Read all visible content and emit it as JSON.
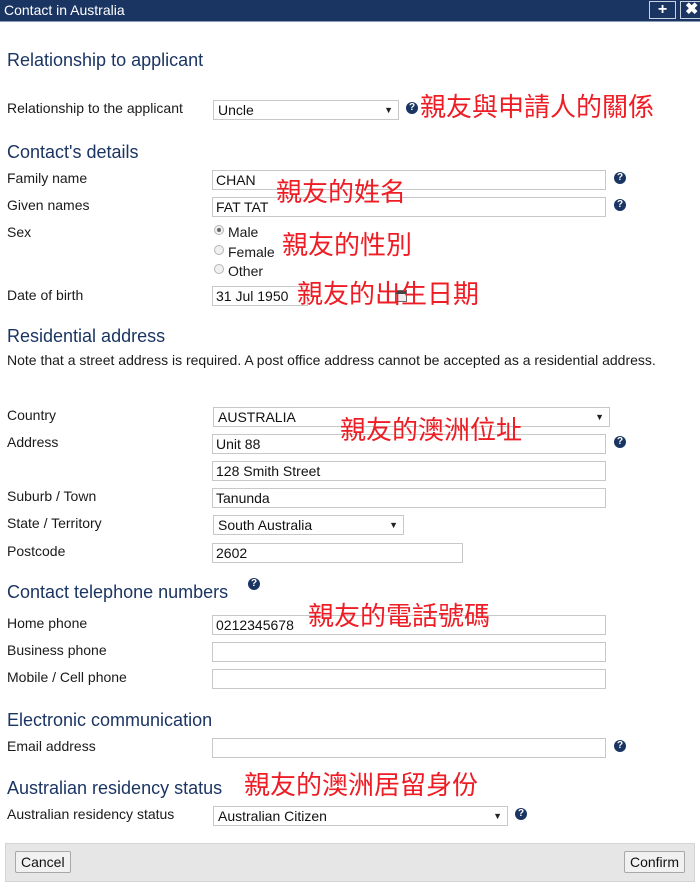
{
  "window": {
    "title": "Contact in Australia",
    "buttons": {
      "maximize_icon": "+",
      "close_icon": "✖"
    }
  },
  "sections": {
    "relationship": {
      "heading": "Relationship to applicant",
      "label": "Relationship to the applicant",
      "value": "Uncle",
      "annotation": "親友與申請人的關係"
    },
    "contact_details": {
      "heading": "Contact's details",
      "family_name_label": "Family name",
      "family_name_value": "CHAN",
      "given_names_label": "Given names",
      "given_names_value": "FAT TAT",
      "name_annotation": "親友的姓名",
      "sex_label": "Sex",
      "sex_options": [
        {
          "label": "Male",
          "checked": true
        },
        {
          "label": "Female",
          "checked": false
        },
        {
          "label": "Other",
          "checked": false
        }
      ],
      "sex_annotation": "親友的性別",
      "dob_label": "Date of birth",
      "dob_value": "31 Jul 1950",
      "dob_annotation": "親友的出生日期"
    },
    "residential_address": {
      "heading": "Residential address",
      "note": "Note that a street address is required. A post office address cannot be accepted as a residential address.",
      "country_label": "Country",
      "country_value": "AUSTRALIA",
      "address_label": "Address",
      "address_line1": "Unit 88",
      "address_line2": "128 Smith Street",
      "suburb_label": "Suburb / Town",
      "suburb_value": "Tanunda",
      "state_label": "State / Territory",
      "state_value": "South Australia",
      "postcode_label": "Postcode",
      "postcode_value": "2602",
      "annotation": "親友的澳洲位址"
    },
    "telephone": {
      "heading": "Contact telephone numbers",
      "home_label": "Home phone",
      "home_value": "0212345678",
      "business_label": "Business phone",
      "business_value": "",
      "mobile_label": "Mobile / Cell phone",
      "mobile_value": "",
      "annotation": "親友的電話號碼"
    },
    "electronic": {
      "heading": "Electronic communication",
      "email_label": "Email address",
      "email_value": ""
    },
    "residency": {
      "heading": "Australian residency status",
      "label": "Australian residency status",
      "value": "Australian Citizen",
      "annotation": "親友的澳洲居留身份"
    }
  },
  "footer": {
    "cancel": "Cancel",
    "confirm": "Confirm"
  },
  "icons": {
    "help": "?",
    "dropdown": "▼"
  },
  "colors": {
    "titlebar": "#1b3563",
    "heading": "#1b3563",
    "annotation": "#ee1c24"
  }
}
